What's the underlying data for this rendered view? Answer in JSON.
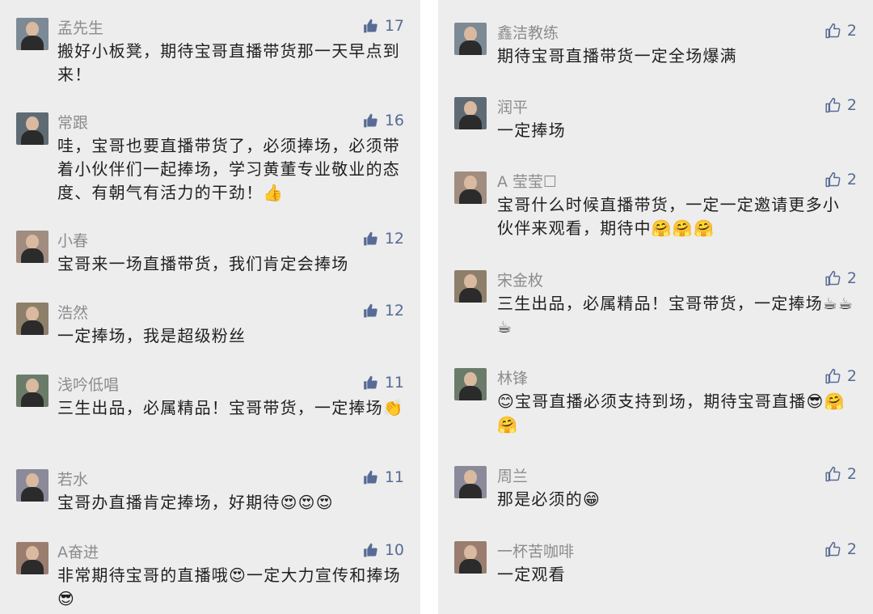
{
  "left_comments": [
    {
      "name": "孟先生",
      "likes": "17",
      "text": "搬好小板凳，期待宝哥直播带货那一天早点到来！"
    },
    {
      "name": "常跟",
      "likes": "16",
      "text": "哇，宝哥也要直播带货了，必须捧场，必须带着小伙伴们一起捧场，学习黄董专业敬业的态度、有朝气有活力的干劲！👍"
    },
    {
      "name": "小春",
      "likes": "12",
      "text": "宝哥来一场直播带货，我们肯定会捧场"
    },
    {
      "name": "浩然",
      "likes": "12",
      "text": "一定捧场，我是超级粉丝"
    },
    {
      "name": "浅吟低唱",
      "likes": "11",
      "text": "三生出品，必属精品！宝哥带货，一定捧场👏"
    },
    {
      "name": "若水",
      "likes": "11",
      "text": "宝哥办直播肯定捧场，好期待😍😍😍"
    },
    {
      "name": "A奋进",
      "likes": "10",
      "text": "非常期待宝哥的直播哦😍一定大力宣传和捧场😎"
    }
  ],
  "right_comments": [
    {
      "name": "鑫洁教练",
      "likes": "2",
      "text": "期待宝哥直播带货一定全场爆满"
    },
    {
      "name": "润平",
      "likes": "2",
      "text": "一定捧场"
    },
    {
      "name": "A 莹莹☐",
      "likes": "2",
      "text": "宝哥什么时候直播带货，一定一定邀请更多小伙伴来观看，期待中🤗🤗🤗"
    },
    {
      "name": "宋金枚",
      "likes": "2",
      "text": "三生出品，必属精品！宝哥带货，一定捧场☕☕☕"
    },
    {
      "name": "林锋",
      "likes": "2",
      "text": "😊宝哥直播必须支持到场，期待宝哥直播😎🤗🤗"
    },
    {
      "name": "周兰",
      "likes": "2",
      "text": "那是必须的😁"
    },
    {
      "name": "一杯苦咖啡",
      "likes": "2",
      "text": "一定观看"
    }
  ],
  "icons": {
    "like": "thumbs-up-icon"
  },
  "colors": {
    "like_filled": "#576b95",
    "like_outline": "#576b95",
    "name": "#8c8c8c",
    "text": "#1f1f1f",
    "panel_bg": "#ededed"
  }
}
